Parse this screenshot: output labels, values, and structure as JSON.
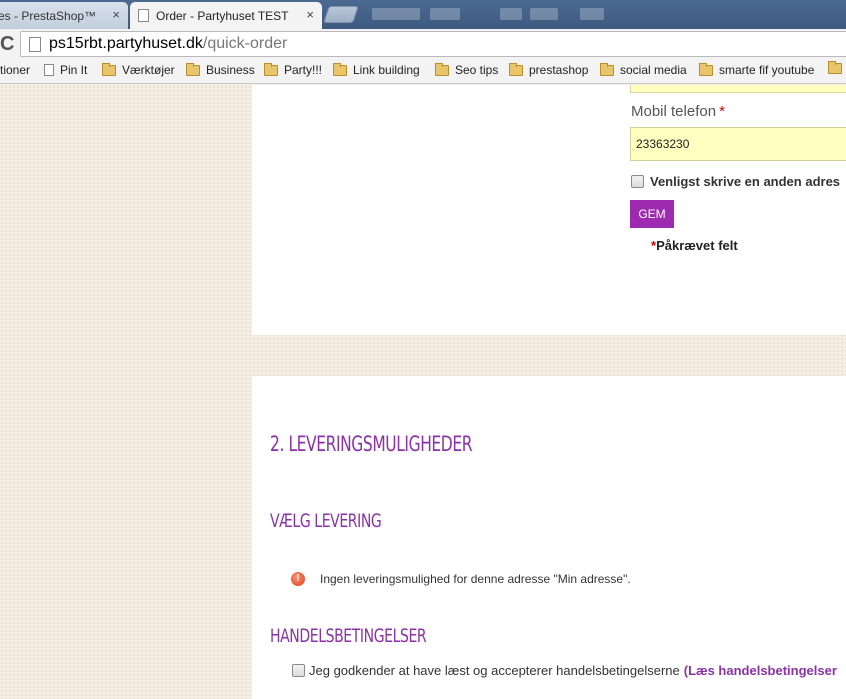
{
  "browser": {
    "tabs": [
      {
        "label": "es - PrestaShop™",
        "close": "×"
      },
      {
        "label": "Order - Partyhuset TEST",
        "close": "×"
      }
    ],
    "url_host": "ps15rbt.partyhuset.dk",
    "url_path": "/quick-order",
    "reload_icon": "C",
    "bookmarks": [
      {
        "label": "tioner",
        "icon": "none"
      },
      {
        "label": "Pin It",
        "icon": "page-icon"
      },
      {
        "label": "Værktøjer",
        "icon": "folder-icon"
      },
      {
        "label": "Business",
        "icon": "folder-icon"
      },
      {
        "label": "Party!!!",
        "icon": "folder-icon"
      },
      {
        "label": "Link building",
        "icon": "folder-icon"
      },
      {
        "label": "Seo tips",
        "icon": "folder-icon"
      },
      {
        "label": "prestashop",
        "icon": "folder-icon"
      },
      {
        "label": "social media",
        "icon": "folder-icon"
      },
      {
        "label": "smarte fif youtube",
        "icon": "folder-icon"
      }
    ]
  },
  "address_form": {
    "mobile_label": "Mobil telefon",
    "required_star": "*",
    "mobile_value": "23363230",
    "alt_address_label": "Venligst skrive en anden adres",
    "save_button": "GEM",
    "required_note_star": "*",
    "required_note": "Påkrævet felt"
  },
  "delivery": {
    "section_heading": "2. LEVERINGSMULIGHEDER",
    "choose_heading": "VÆLG LEVERING",
    "warning_icon": "!",
    "warning_text": "Ingen leveringsmulighed for denne adresse \"Min adresse\".",
    "terms_heading": "HANDELSBETINGELSER",
    "terms_text": "Jeg godkender at have læst og accepterer handelsbetingelserne",
    "terms_link": "(Læs handelsbetingelser"
  },
  "colors": {
    "accent_purple": "#8b32a8",
    "button_purple": "#9d2ab0",
    "input_yellow": "#ffffc0",
    "page_bg": "#f5eee3"
  }
}
